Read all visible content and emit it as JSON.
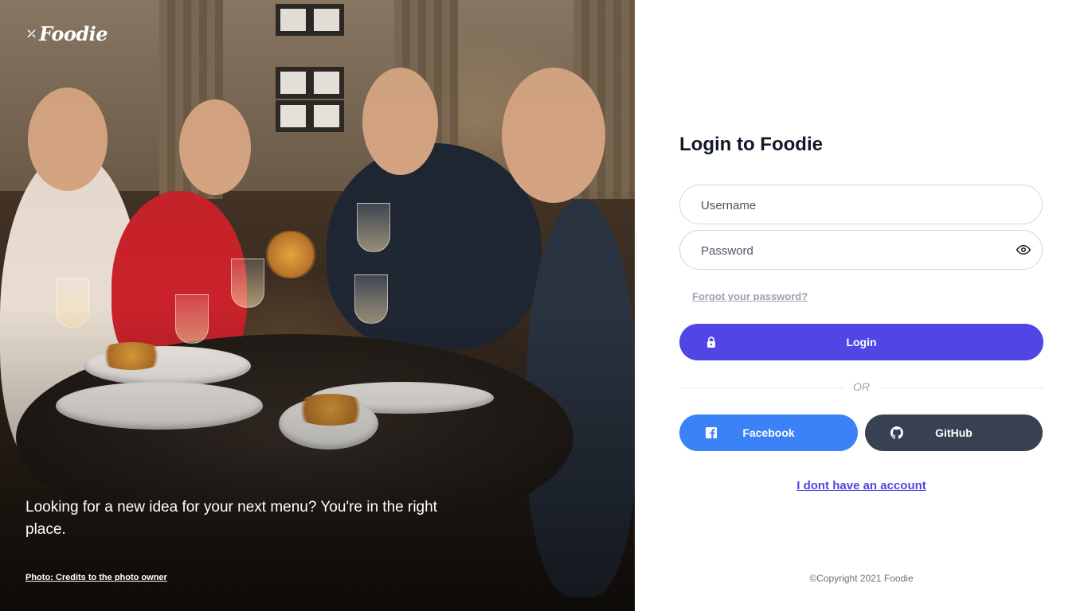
{
  "brand": {
    "name": "Foodie",
    "logo_icon": "chef-whisk-icon"
  },
  "hero": {
    "tagline": "Looking for a new idea for your next menu? You're in the right place.",
    "photo_credit": "Photo: Credits to the photo owner"
  },
  "login": {
    "title": "Login to Foodie",
    "username_placeholder": "Username",
    "password_placeholder": "Password",
    "password_toggle_icon": "eye-icon",
    "forgot_password": "Forgot your password?",
    "login_button": "Login",
    "login_icon": "lock-icon",
    "or_text": "OR",
    "facebook_button": "Facebook",
    "facebook_icon": "facebook-icon",
    "github_button": "GitHub",
    "github_icon": "github-icon",
    "signup_link": "I dont have an account",
    "copyright": "©Copyright 2021 Foodie"
  },
  "colors": {
    "primary": "#4f46e5",
    "facebook": "#3b82f6",
    "github": "#374151",
    "title_text": "#111827",
    "muted_text": "#9ca3af"
  }
}
